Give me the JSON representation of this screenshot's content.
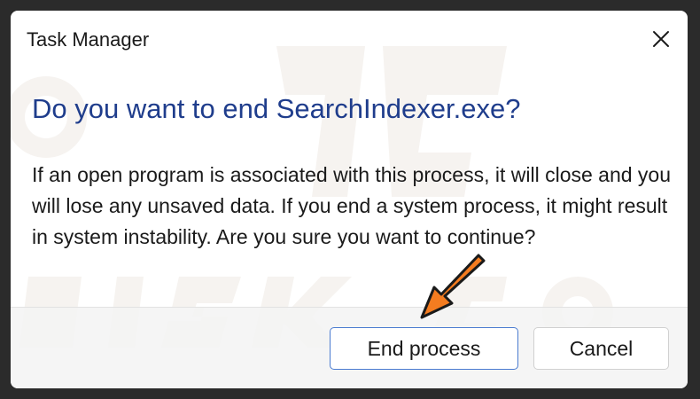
{
  "window": {
    "title": "Task Manager",
    "close_icon": "close-icon"
  },
  "dialog": {
    "heading": "Do you want to end SearchIndexer.exe?",
    "message": "If an open program is associated with this process, it will close and you will lose any unsaved data. If you end a system process, it might result in system instability. Are you sure you want to continue?"
  },
  "buttons": {
    "end_process_label": "End process",
    "cancel_label": "Cancel"
  },
  "colors": {
    "heading": "#1f3d8c",
    "primary_border": "#4a7bd0",
    "annotation_arrow": "#f47c20"
  }
}
